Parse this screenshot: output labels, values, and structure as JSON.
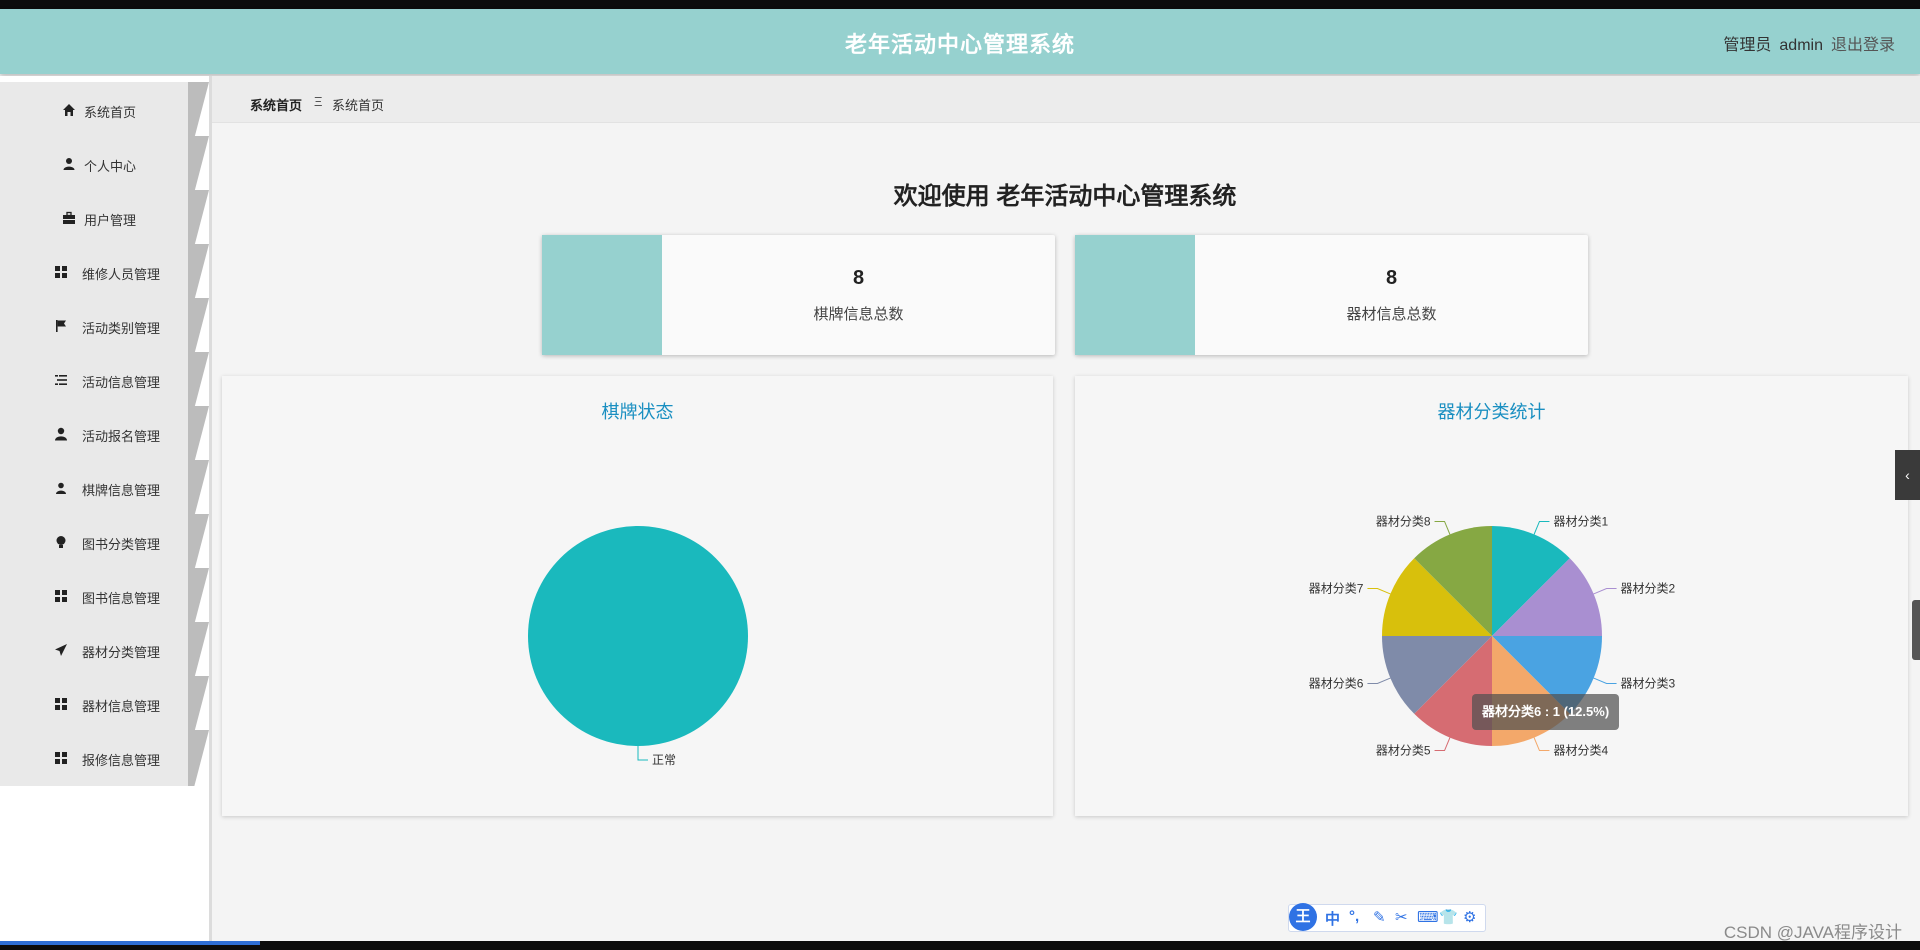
{
  "header": {
    "app_title": "老年活动中心管理系统",
    "role_label": "管理员",
    "username": "admin",
    "logout_label": "退出登录"
  },
  "sidebar": {
    "items": [
      {
        "label": "系统首页",
        "icon": "home-icon"
      },
      {
        "label": "个人中心",
        "icon": "person-icon"
      },
      {
        "label": "用户管理",
        "icon": "briefcase-icon"
      },
      {
        "label": "维修人员管理",
        "icon": "grid-icon"
      },
      {
        "label": "活动类别管理",
        "icon": "flag-icon"
      },
      {
        "label": "活动信息管理",
        "icon": "list-icon"
      },
      {
        "label": "活动报名管理",
        "icon": "user-icon"
      },
      {
        "label": "棋牌信息管理",
        "icon": "user-small-icon"
      },
      {
        "label": "图书分类管理",
        "icon": "bulb-icon"
      },
      {
        "label": "图书信息管理",
        "icon": "grid-icon"
      },
      {
        "label": "器材分类管理",
        "icon": "send-icon"
      },
      {
        "label": "器材信息管理",
        "icon": "grid-icon"
      },
      {
        "label": "报修信息管理",
        "icon": "grid-icon"
      }
    ]
  },
  "breadcrumb": {
    "home": "系统首页",
    "separator": "Ξ",
    "current": "系统首页"
  },
  "welcome": "欢迎使用 老年活动中心管理系统",
  "stats": [
    {
      "value": "8",
      "label": "棋牌信息总数",
      "color": "#96d1cf"
    },
    {
      "value": "8",
      "label": "器材信息总数",
      "color": "#96d1cf"
    }
  ],
  "chart_data": [
    {
      "type": "pie",
      "title": "棋牌状态",
      "categories": [
        "正常"
      ],
      "values": [
        1
      ],
      "colors": [
        "#1ab9bd"
      ]
    },
    {
      "type": "pie",
      "title": "器材分类统计",
      "categories": [
        "器材分类1",
        "器材分类2",
        "器材分类3",
        "器材分类4",
        "器材分类5",
        "器材分类6",
        "器材分类7",
        "器材分类8"
      ],
      "values": [
        1,
        1,
        1,
        1,
        1,
        1,
        1,
        1
      ],
      "colors": [
        "#1ab9bd",
        "#a98fd1",
        "#4aa3e2",
        "#f3a86a",
        "#d66c72",
        "#7f8ba9",
        "#d8c00c",
        "#86a843"
      ],
      "tooltip": "器材分类6 : 1 (12.5%)"
    }
  ],
  "ime": {
    "logo": "王",
    "buttons": [
      "中",
      "°,",
      "✎",
      "✂",
      "⌨",
      "👕",
      "⚙"
    ]
  },
  "watermark": "CSDN @JAVA程序设计"
}
